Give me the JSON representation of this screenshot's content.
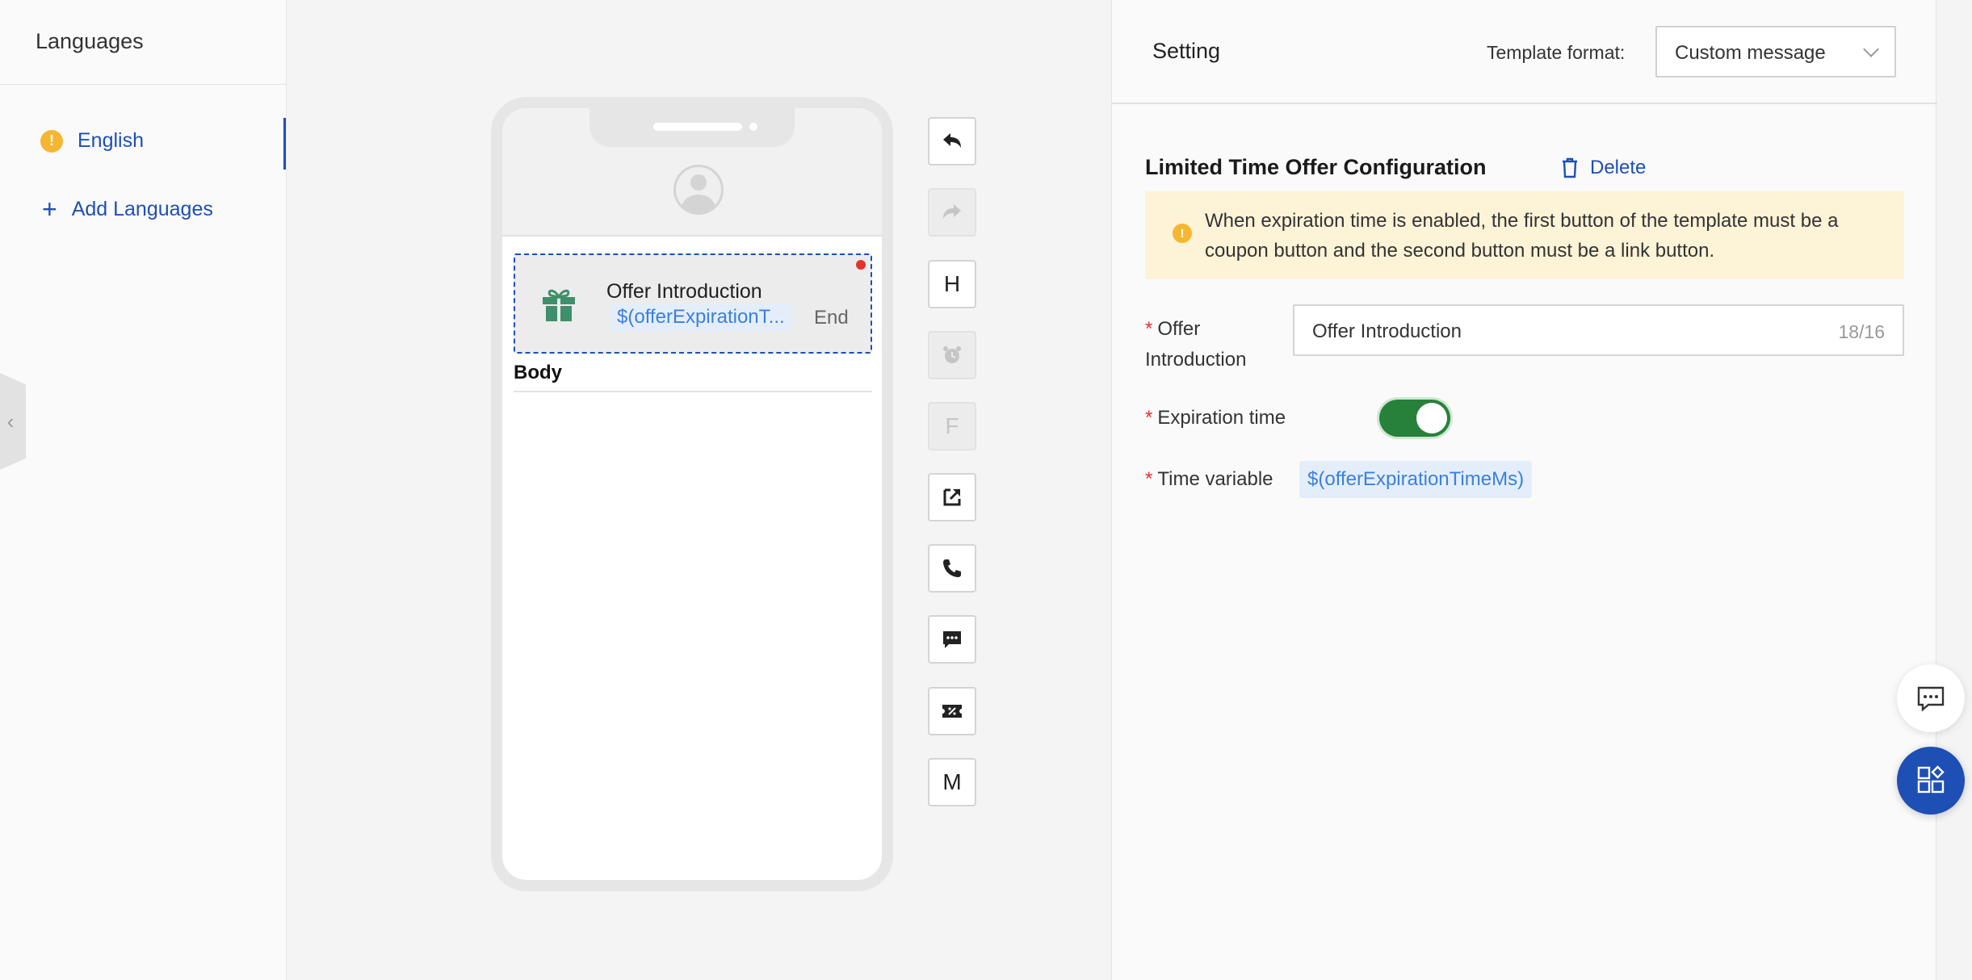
{
  "languages": {
    "title": "Languages",
    "items": [
      {
        "label": "English",
        "status_icon": "warning-icon"
      }
    ],
    "add_label": "Add Languages"
  },
  "preview": {
    "offer_title": "Offer Introduction",
    "offer_variable": "$(offerExpirationT...",
    "offer_end": "End",
    "body_label": "Body"
  },
  "toolbar": [
    {
      "name": "undo-button",
      "icon": "undo-icon",
      "enabled": true
    },
    {
      "name": "redo-button",
      "icon": "redo-icon",
      "enabled": false
    },
    {
      "name": "header-button",
      "icon": "header-icon",
      "text": "H",
      "enabled": true
    },
    {
      "name": "alarm-button",
      "icon": "alarm-clock-icon",
      "enabled": false
    },
    {
      "name": "footer-button",
      "icon": "footer-icon",
      "text": "F",
      "enabled": false
    },
    {
      "name": "link-button",
      "icon": "external-link-icon",
      "enabled": true
    },
    {
      "name": "phone-button",
      "icon": "phone-icon",
      "enabled": true
    },
    {
      "name": "quick-reply-button",
      "icon": "chat-bubble-icon",
      "enabled": true
    },
    {
      "name": "coupon-button",
      "icon": "coupon-icon",
      "enabled": true
    },
    {
      "name": "media-button",
      "icon": "media-icon",
      "text": "M",
      "enabled": true
    }
  ],
  "settings": {
    "title": "Setting",
    "template_format_label": "Template format:",
    "template_format_value": "Custom message",
    "config_title": "Limited Time Offer Configuration",
    "delete_label": "Delete",
    "notice": "When expiration time is enabled, the first button of the template must be a coupon button and the second button must be a link button.",
    "offer_intro_label_line1": "Offer",
    "offer_intro_label_line2": "Introduction",
    "offer_intro_value": "Offer Introduction",
    "offer_intro_count": "18/16",
    "expiration_label": "Expiration time",
    "expiration_enabled": true,
    "time_variable_label": "Time variable",
    "time_variable_value": "$(offerExpirationTimeMs)",
    "required_mark": "*"
  },
  "colors": {
    "accent": "#1d4fb5",
    "warning": "#f5b731",
    "toggle_on": "#27813a",
    "required": "#e5322d",
    "variable": "#3b7fe0"
  }
}
